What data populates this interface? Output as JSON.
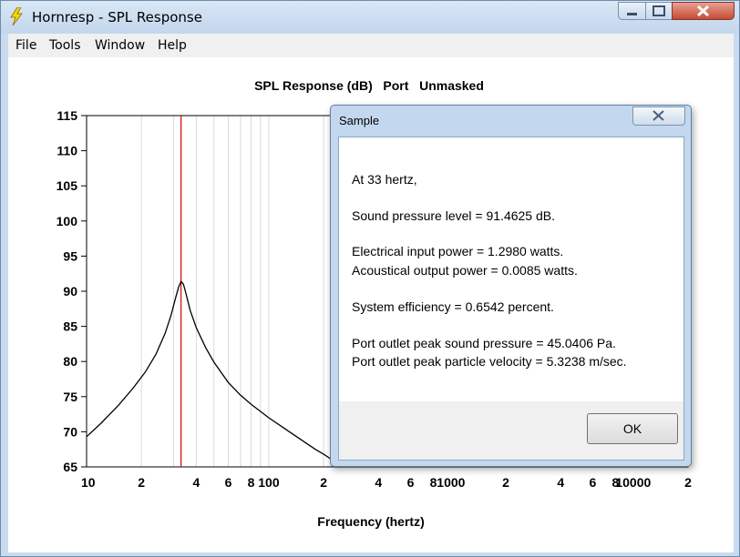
{
  "window": {
    "title": "Hornresp - SPL Response",
    "icon": "lightning-bolt-icon",
    "controls": [
      "minimize-icon",
      "maximize-icon",
      "close-icon"
    ]
  },
  "menu": {
    "items": [
      "File",
      "Tools",
      "Window",
      "Help"
    ]
  },
  "chart_data": {
    "type": "line",
    "title": "SPL Response (dB)   Port   Unmasked",
    "xlabel": "Frequency (hertz)",
    "ylabel": "",
    "x_scale": "log",
    "xlim": [
      10,
      20000
    ],
    "ylim": [
      65,
      115
    ],
    "y_ticks": [
      "115",
      "110",
      "105",
      "100",
      "95",
      "90",
      "85",
      "80",
      "75",
      "70",
      "65"
    ],
    "x_tick_labels": [
      {
        "x": 10,
        "label": "10"
      },
      {
        "x": 20,
        "label": "2"
      },
      {
        "x": 40,
        "label": "4"
      },
      {
        "x": 60,
        "label": "6"
      },
      {
        "x": 80,
        "label": "8"
      },
      {
        "x": 100,
        "label": "100"
      },
      {
        "x": 200,
        "label": "2"
      },
      {
        "x": 400,
        "label": "4"
      },
      {
        "x": 600,
        "label": "6"
      },
      {
        "x": 800,
        "label": "8"
      },
      {
        "x": 1000,
        "label": "1000"
      },
      {
        "x": 2000,
        "label": "2"
      },
      {
        "x": 4000,
        "label": "4"
      },
      {
        "x": 6000,
        "label": "6"
      },
      {
        "x": 8000,
        "label": "8"
      },
      {
        "x": 10000,
        "label": "10000"
      },
      {
        "x": 20000,
        "label": "2"
      }
    ],
    "grid": true,
    "marker_frequency": 33,
    "series": [
      {
        "color": "#000000",
        "x": [
          10,
          12,
          15,
          18,
          21,
          24,
          27,
          29,
          31,
          32,
          33,
          34,
          35,
          37,
          40,
          45,
          50,
          60,
          70,
          80,
          100,
          120,
          150,
          180,
          200,
          220
        ],
        "y": [
          69.3,
          71.2,
          73.8,
          76.2,
          78.5,
          81.0,
          84.0,
          86.5,
          89.3,
          90.6,
          91.4,
          91.0,
          89.8,
          87.3,
          84.8,
          82.0,
          79.9,
          77.0,
          75.2,
          73.9,
          72.0,
          70.6,
          68.9,
          67.5,
          66.8,
          66.1
        ]
      }
    ],
    "marker_color": "#d40000"
  },
  "dialog": {
    "title": "Sample",
    "lines": [
      "At 33 hertz,",
      "Sound pressure level = 91.4625 dB.",
      "Electrical input power = 1.2980 watts.",
      "Acoustical output power = 0.0085 watts.",
      "System efficiency = 0.6542 percent.",
      "Port outlet peak sound pressure = 45.0406 Pa.",
      "Port outlet peak particle velocity = 5.3238 m/sec."
    ],
    "ok_label": "OK"
  }
}
